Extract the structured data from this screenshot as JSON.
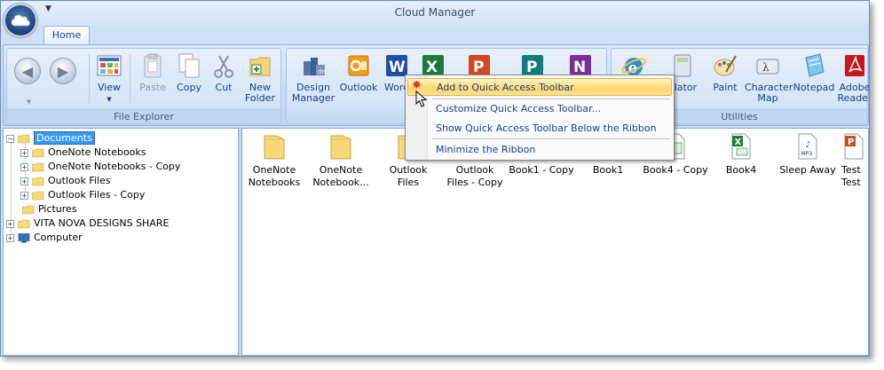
{
  "window": {
    "title": "Cloud Manager"
  },
  "tabs": [
    {
      "label": "Home"
    }
  ],
  "ribbon": {
    "file_explorer": {
      "label": "File Explorer",
      "buttons": {
        "view": "View",
        "paste": "Paste",
        "copy": "Copy",
        "cut": "Cut",
        "new_folder_1": "New",
        "new_folder_2": "Folder"
      }
    },
    "apps": {
      "buttons": {
        "design_manager_1": "Design",
        "design_manager_2": "Manager",
        "outlook": "Outlook",
        "word": "Word"
      }
    },
    "utilities": {
      "label": "Utilities",
      "buttons": {
        "calculator": "ulator",
        "paint": "Paint",
        "charmap_1": "Character",
        "charmap_2": "Map",
        "notepad": "Notepad",
        "adobe_1": "Adobe",
        "adobe_2": "Reader"
      }
    }
  },
  "context_menu": {
    "items": [
      "Add to Quick Access Toolbar",
      "Customize Quick Access Toolbar...",
      "Show Quick Access Toolbar Below the Ribbon",
      "Minimize the Ribbon"
    ]
  },
  "tree": {
    "root": "Documents",
    "children": [
      "OneNote Notebooks",
      "OneNote Notebooks - Copy",
      "Outlook Files",
      "Outlook Files - Copy"
    ],
    "pictures": "Pictures",
    "share": "VITA NOVA DESIGNS SHARE",
    "computer": "Computer"
  },
  "files": [
    {
      "line1": "OneNote",
      "line2": "Notebooks",
      "icon": "folder-icon"
    },
    {
      "line1": "OneNote",
      "line2": "Notebook...",
      "icon": "folder-icon"
    },
    {
      "line1": "Outlook",
      "line2": "Files",
      "icon": "folder-icon"
    },
    {
      "line1": "Outlook",
      "line2": "Files - Copy",
      "icon": "folder-icon"
    },
    {
      "line1": "Book1 - Copy",
      "line2": "",
      "icon": "excel-file-icon"
    },
    {
      "line1": "Book1",
      "line2": "",
      "icon": "excel-file-icon"
    },
    {
      "line1": "Book4 - Copy",
      "line2": "",
      "icon": "excel-file-icon"
    },
    {
      "line1": "Book4",
      "line2": "",
      "icon": "excel-file-icon"
    },
    {
      "line1": "Sleep Away",
      "line2": "",
      "icon": "mp3-file-icon"
    },
    {
      "line1": "Test",
      "line2": "Test",
      "icon": "powerpoint-file-icon"
    }
  ],
  "file_badges": {
    "mp3": "MP3"
  },
  "colors": {
    "selection": "#3399ff",
    "menu_highlight": "#ffd570",
    "ribbon_text": "#15428b"
  }
}
